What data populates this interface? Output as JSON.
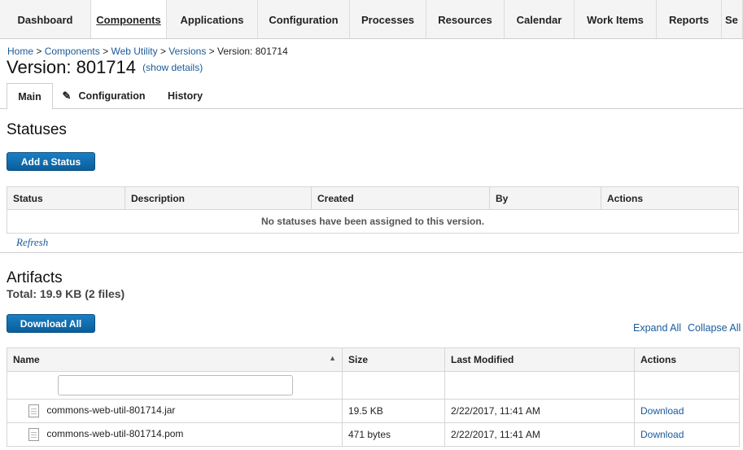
{
  "nav": {
    "items": [
      "Dashboard",
      "Components",
      "Applications",
      "Configuration",
      "Processes",
      "Resources",
      "Calendar",
      "Work Items",
      "Reports",
      "Se"
    ],
    "active": "Components"
  },
  "breadcrumb": {
    "items": [
      "Home",
      "Components",
      "Web Utility",
      "Versions"
    ],
    "separator": ">",
    "current": "Version: 801714"
  },
  "page": {
    "title": "Version: 801714",
    "show_details": "(show details)"
  },
  "tabs": {
    "main": "Main",
    "configuration": "Configuration",
    "history": "History",
    "configuration_icon": "pencil-icon"
  },
  "statuses": {
    "title": "Statuses",
    "add_button": "Add a Status",
    "columns": [
      "Status",
      "Description",
      "Created",
      "By",
      "Actions"
    ],
    "empty_message": "No statuses have been assigned to this version.",
    "refresh": "Refresh"
  },
  "artifacts": {
    "title": "Artifacts",
    "total": "Total: 19.9 KB (2 files)",
    "download_all": "Download All",
    "expand_all": "Expand All",
    "collapse_all": "Collapse All",
    "columns": [
      "Name",
      "Size",
      "Last Modified",
      "Actions"
    ],
    "filter_value": "",
    "files": [
      {
        "name": "commons-web-util-801714.jar",
        "size": "19.5 KB",
        "modified": "2/22/2017, 11:41 AM",
        "action": "Download"
      },
      {
        "name": "commons-web-util-801714.pom",
        "size": "471 bytes",
        "modified": "2/22/2017, 11:41 AM",
        "action": "Download"
      }
    ]
  },
  "colors": {
    "link": "#1a5a9a",
    "button": "#0b5e9b",
    "header_bg": "#f4f4f4"
  }
}
